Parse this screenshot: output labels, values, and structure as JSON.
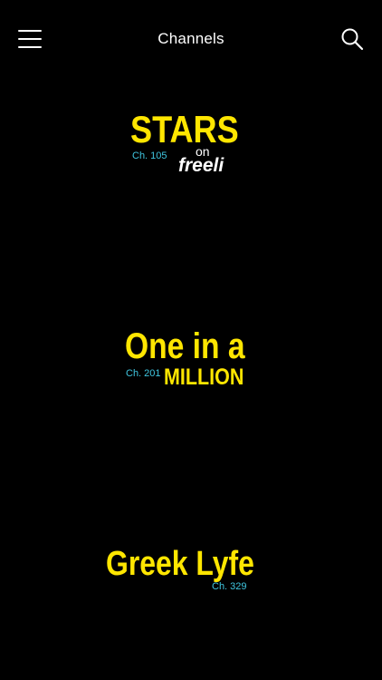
{
  "nav": {
    "title": "Channels",
    "menu_icon": "hamburger-menu-icon",
    "search_icon": "search-icon"
  },
  "channels": [
    {
      "logo_line1": "STARS",
      "logo_on": "on",
      "logo_brand": "freeli",
      "channel_number": "Ch. 105"
    },
    {
      "logo_line1": "One in a",
      "logo_line2": "MILLION",
      "channel_number": "Ch. 201"
    },
    {
      "logo_line1": "Greek Lyfe",
      "channel_number": "Ch. 329"
    }
  ],
  "colors": {
    "background": "#000000",
    "logo_yellow": "#ffe600",
    "channel_number_cyan": "#3fc6e0",
    "text_white": "#ffffff"
  }
}
